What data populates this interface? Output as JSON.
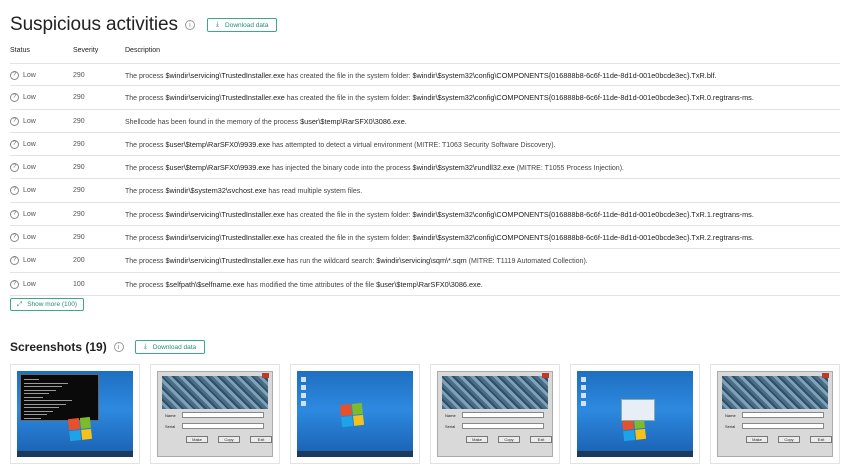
{
  "suspicious": {
    "title": "Suspicious activities",
    "download_label": "Download data",
    "columns": {
      "status": "Status",
      "severity": "Severity",
      "description": "Description"
    },
    "rows": [
      {
        "status": "Low",
        "severity": "290",
        "description": "The process $windir\\servicing\\TrustedInstaller.exe has created the file in the system folder: $windir\\$system32\\config\\COMPONENTS{016888b8-6c6f-11de-8d1d-001e0bcde3ec}.TxR.blf."
      },
      {
        "status": "Low",
        "severity": "290",
        "description": "The process $windir\\servicing\\TrustedInstaller.exe has created the file in the system folder: $windir\\$system32\\config\\COMPONENTS{016888b8-6c6f-11de-8d1d-001e0bcde3ec}.TxR.0.regtrans-ms."
      },
      {
        "status": "Low",
        "severity": "290",
        "description": "Shellcode has been found in the memory of the process $user\\$temp\\RarSFX0\\3086.exe."
      },
      {
        "status": "Low",
        "severity": "290",
        "description": "The process $user\\$temp\\RarSFX0\\9939.exe has attempted to detect a virtual environment (MITRE: T1063 Security Software Discovery)."
      },
      {
        "status": "Low",
        "severity": "290",
        "description": "The process $user\\$temp\\RarSFX0\\9939.exe has injected the binary code into the process $windir\\$system32\\rundll32.exe (MITRE: T1055 Process Injection)."
      },
      {
        "status": "Low",
        "severity": "290",
        "description": "The process $windir\\$system32\\svchost.exe has read multiple system files."
      },
      {
        "status": "Low",
        "severity": "290",
        "description": "The process $windir\\servicing\\TrustedInstaller.exe has created the file in the system folder: $windir\\$system32\\config\\COMPONENTS{016888b8-6c6f-11de-8d1d-001e0bcde3ec}.TxR.1.regtrans-ms."
      },
      {
        "status": "Low",
        "severity": "290",
        "description": "The process $windir\\servicing\\TrustedInstaller.exe has created the file in the system folder: $windir\\$system32\\config\\COMPONENTS{016888b8-6c6f-11de-8d1d-001e0bcde3ec}.TxR.2.regtrans-ms."
      },
      {
        "status": "Low",
        "severity": "200",
        "description": "The process $windir\\servicing\\TrustedInstaller.exe has run the wildcard search: $windir\\servicing\\sqm\\*.sqm (MITRE: T1119 Automated Collection)."
      },
      {
        "status": "Low",
        "severity": "100",
        "description": "The process $selfpath\\$selfname.exe has modified the time attributes of the file $user\\$temp\\RarSFX0\\3086.exe."
      }
    ],
    "show_more_label": "Show more (100)"
  },
  "screenshots": {
    "title": "Screenshots (19)",
    "download_label": "Download data",
    "thumbnails": [
      {
        "kind": "desktop-console"
      },
      {
        "kind": "app-window",
        "name_label": "Name",
        "serial_label": "Serial",
        "buttons": [
          "Make",
          "Copy",
          "Exit"
        ]
      },
      {
        "kind": "desktop"
      },
      {
        "kind": "app-window",
        "name_label": "Name",
        "serial_label": "Serial",
        "buttons": [
          "Make",
          "Copy",
          "Exit"
        ]
      },
      {
        "kind": "desktop-dialog"
      },
      {
        "kind": "app-window",
        "name_label": "Name",
        "serial_label": "Serial",
        "buttons": [
          "Make",
          "Copy",
          "Exit"
        ]
      }
    ]
  },
  "icons": {
    "info": "info-icon",
    "question": "question-icon",
    "download": "download-icon",
    "expand": "expand-icon"
  },
  "colors": {
    "accent": "#3aa88a",
    "row_border": "#e3e3e3",
    "desktop_blue": "#2d8ae0"
  }
}
